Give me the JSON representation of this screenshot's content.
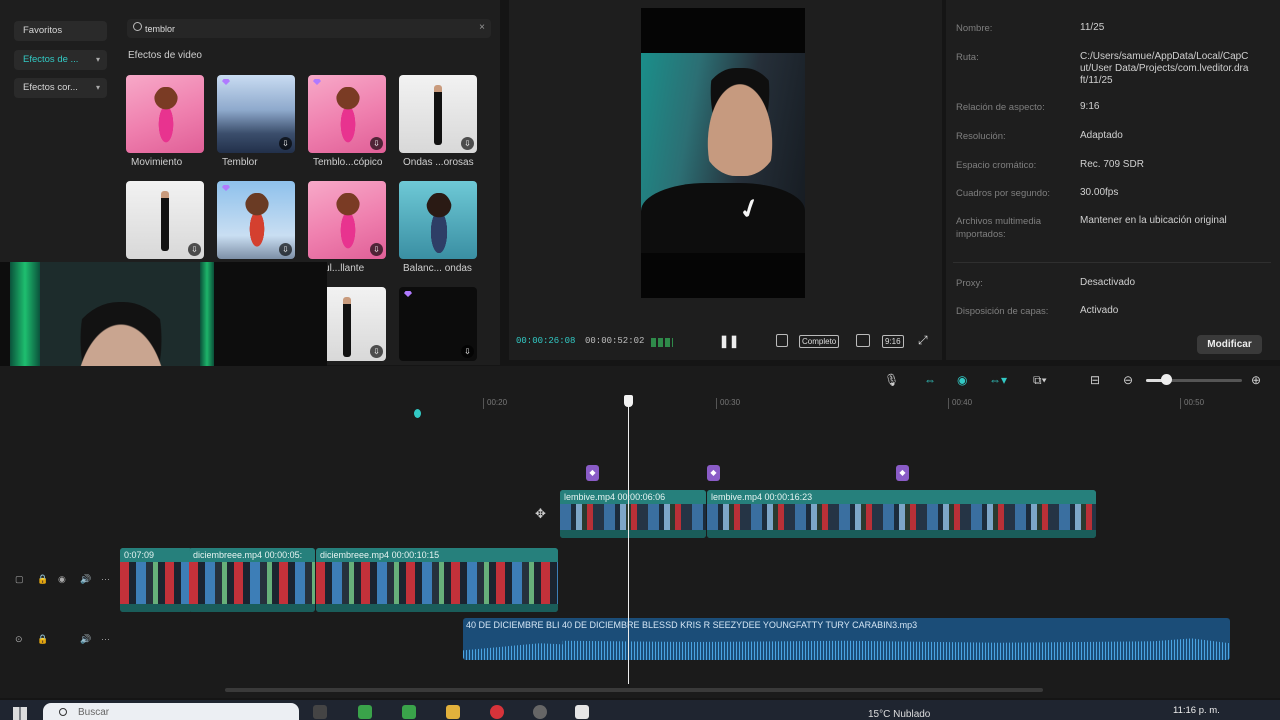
{
  "search": {
    "value": "temblor"
  },
  "categories": [
    {
      "label": "Favoritos"
    },
    {
      "label": "Efectos de ..."
    },
    {
      "label": "Efectos cor..."
    }
  ],
  "effects_section": {
    "title": "Efectos de video",
    "items": [
      {
        "label": "Movimiento",
        "bg": "pink",
        "download": false,
        "premium": false
      },
      {
        "label": "Temblor",
        "bg": "city",
        "download": true,
        "premium": true
      },
      {
        "label": "Temblo...cópico",
        "bg": "pink",
        "download": true,
        "premium": true
      },
      {
        "label": "Ondas ...orosas",
        "bg": "white",
        "download": true,
        "premium": false
      },
      {
        "label": "",
        "bg": "white",
        "download": true,
        "premium": false
      },
      {
        "label": "",
        "bg": "sky",
        "download": true,
        "premium": true
      },
      {
        "label": "ndul...llante",
        "bg": "pink",
        "download": true,
        "premium": false
      },
      {
        "label": "Balanc... ondas",
        "bg": "teal",
        "download": false,
        "premium": false
      },
      {
        "label": "",
        "bg": "white",
        "download": true,
        "premium": false
      },
      {
        "label": "",
        "bg": "dark",
        "download": true,
        "premium": true
      }
    ]
  },
  "player": {
    "current_time": "00:00:26:08",
    "total_time": "00:00:52:02",
    "ratio_button": "Completo",
    "aspect_button": "9:16"
  },
  "details": {
    "rows": [
      {
        "label": "Nombre:",
        "value": "11/25"
      },
      {
        "label": "Ruta:",
        "value": "C:/Users/samue/AppData/Local/CapCut/User Data/Projects/com.lveditor.draft/11/25"
      },
      {
        "label": "Relación de aspecto:",
        "value": "9:16"
      },
      {
        "label": "Resolución:",
        "value": "Adaptado"
      },
      {
        "label": "Espacio cromático:",
        "value": "Rec. 709 SDR"
      },
      {
        "label": "Cuadros por segundo:",
        "value": "30.00fps"
      },
      {
        "label": "Archivos multimedia importados:",
        "value": "Mantener en la ubicación original"
      },
      {
        "label": "Proxy:",
        "value": "Desactivado"
      },
      {
        "label": "Disposición de capas:",
        "value": "Activado"
      }
    ],
    "modify_button": "Modificar"
  },
  "timeline": {
    "ruler": [
      "00:20",
      "00:30",
      "00:40",
      "00:50"
    ],
    "overlay_clips": [
      {
        "name": "lembive.mp4",
        "duration": "00:00:06:06"
      },
      {
        "name": "lembive.mp4",
        "duration": "00:00:16:23"
      }
    ],
    "main_clips": [
      {
        "name": "",
        "duration": "0:07:09"
      },
      {
        "name": "diciembreee.mp4",
        "duration": "00:00:05:"
      },
      {
        "name": "diciembreee.mp4",
        "duration": "00:00:10:15"
      }
    ],
    "audio_clip": "40 DE DICIEMBRE  BLI   40 DE DICIEMBRE  BLESSD  KRIS R  SEEZYDEE  YOUNGFATTY  TURY  CARABIN3.mp3"
  },
  "taskbar": {
    "search_placeholder": "Buscar",
    "weather": "15°C  Nublado",
    "clock": "11:16 p. m."
  },
  "colors": {
    "accent": "#32c9c4",
    "clip": "#1f6d6a",
    "audio": "#1b4d78",
    "marker": "#8a5cc7"
  }
}
